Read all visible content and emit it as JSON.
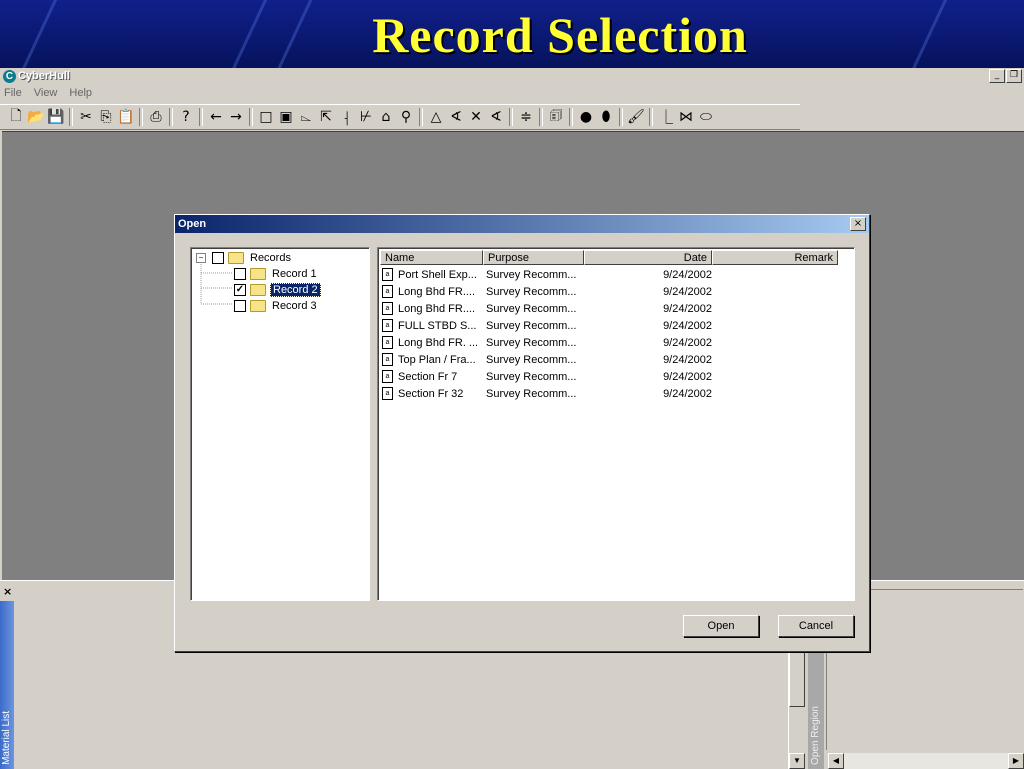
{
  "slide": {
    "title": "Record Selection"
  },
  "app": {
    "name": "CyberHull",
    "logo_glyph": "C",
    "menu": [
      "File",
      "View",
      "Help"
    ],
    "window_buttons": [
      "_",
      "❐"
    ]
  },
  "toolbar": [
    {
      "icon": "new-file-icon",
      "glyph": "🗋"
    },
    {
      "icon": "open-folder-icon",
      "glyph": "📂"
    },
    {
      "icon": "save-icon",
      "glyph": "💾"
    },
    {
      "sep": true
    },
    {
      "icon": "cut-icon",
      "glyph": "✂"
    },
    {
      "icon": "copy-icon",
      "glyph": "⎘"
    },
    {
      "icon": "paste-icon",
      "glyph": "📋"
    },
    {
      "sep": true
    },
    {
      "icon": "print-icon",
      "glyph": "⎙"
    },
    {
      "sep": true
    },
    {
      "icon": "help-icon",
      "glyph": "?"
    },
    {
      "sep": true
    },
    {
      "icon": "arrow-left-icon",
      "glyph": "←"
    },
    {
      "icon": "arrow-right-icon",
      "glyph": "→"
    },
    {
      "sep": true
    },
    {
      "icon": "rectangle-icon",
      "glyph": "□"
    },
    {
      "icon": "frame-icon",
      "glyph": "▣"
    },
    {
      "icon": "callout-icon",
      "glyph": "⌳"
    },
    {
      "icon": "pointer-icon",
      "glyph": "⇱"
    },
    {
      "icon": "marker-icon",
      "glyph": "⸡"
    },
    {
      "icon": "bracket-icon",
      "glyph": "⊬"
    },
    {
      "icon": "shape-icon",
      "glyph": "⌂"
    },
    {
      "icon": "weld-icon",
      "glyph": "⚲"
    },
    {
      "sep": true
    },
    {
      "icon": "triangle-icon",
      "glyph": "△"
    },
    {
      "icon": "angle-icon",
      "glyph": "∢"
    },
    {
      "icon": "cross-icon",
      "glyph": "✕"
    },
    {
      "icon": "angle2-icon",
      "glyph": "∢"
    },
    {
      "sep": true
    },
    {
      "icon": "align-icon",
      "glyph": "≑"
    },
    {
      "sep": true
    },
    {
      "icon": "note-icon",
      "glyph": "🗊"
    },
    {
      "sep": true
    },
    {
      "icon": "dot-icon",
      "glyph": "●"
    },
    {
      "icon": "bullet-icon",
      "glyph": "⬮"
    },
    {
      "sep": true
    },
    {
      "icon": "brush-icon",
      "glyph": "🖌"
    },
    {
      "sep": true
    },
    {
      "icon": "step-icon",
      "glyph": "⎿"
    },
    {
      "icon": "join-icon",
      "glyph": "⋈"
    },
    {
      "icon": "ellipse-icon",
      "glyph": "⬭"
    }
  ],
  "bottom": {
    "close_glyph": "×",
    "material_tab": "Material List",
    "open_region_tab": "Open Region"
  },
  "dialog": {
    "title": "Open",
    "close_glyph": "×",
    "tree": {
      "root": {
        "label": "Records",
        "expander": "−",
        "checked": false
      },
      "children": [
        {
          "label": "Record 1",
          "checked": false,
          "selected": false
        },
        {
          "label": "Record 2",
          "checked": true,
          "selected": true
        },
        {
          "label": "Record 3",
          "checked": false,
          "selected": false
        }
      ]
    },
    "columns": [
      "Name",
      "Purpose",
      "Date",
      "Remark"
    ],
    "rows": [
      {
        "name": "Port Shell Exp...",
        "purpose": "Survey Recomm...",
        "date": "9/24/2002",
        "remark": ""
      },
      {
        "name": "Long Bhd FR....",
        "purpose": "Survey Recomm...",
        "date": "9/24/2002",
        "remark": ""
      },
      {
        "name": "Long Bhd FR....",
        "purpose": "Survey Recomm...",
        "date": "9/24/2002",
        "remark": ""
      },
      {
        "name": "FULL STBD S...",
        "purpose": "Survey Recomm...",
        "date": "9/24/2002",
        "remark": ""
      },
      {
        "name": "Long Bhd FR. ...",
        "purpose": "Survey Recomm...",
        "date": "9/24/2002",
        "remark": ""
      },
      {
        "name": "Top Plan / Fra...",
        "purpose": "Survey Recomm...",
        "date": "9/24/2002",
        "remark": ""
      },
      {
        "name": "Section Fr 7",
        "purpose": "Survey Recomm...",
        "date": "9/24/2002",
        "remark": ""
      },
      {
        "name": "Section Fr 32",
        "purpose": "Survey Recomm...",
        "date": "9/24/2002",
        "remark": ""
      }
    ],
    "buttons": {
      "open": "Open",
      "cancel": "Cancel"
    }
  }
}
